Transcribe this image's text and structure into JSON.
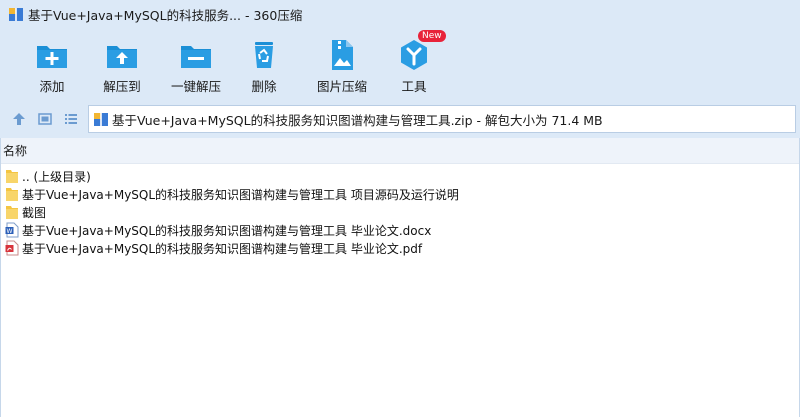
{
  "window": {
    "title": "基于Vue+Java+MySQL的科技服务... - 360压缩"
  },
  "toolbar": {
    "items": [
      {
        "label": "添加",
        "icon": "add-icon"
      },
      {
        "label": "解压到",
        "icon": "extract-to-icon"
      },
      {
        "label": "一键解压",
        "icon": "one-key-extract-icon"
      },
      {
        "label": "删除",
        "icon": "recycle-delete-icon"
      },
      {
        "label": "图片压缩",
        "icon": "image-compress-icon"
      },
      {
        "label": "工具",
        "icon": "tools-icon",
        "badge": "New"
      }
    ]
  },
  "addressbar": {
    "path": "基于Vue+Java+MySQL的科技服务知识图谱构建与管理工具.zip - 解包大小为 71.4 MB"
  },
  "filelist": {
    "column_name": "名称",
    "rows": [
      {
        "name": ".. (上级目录)",
        "type": "folder"
      },
      {
        "name": "基于Vue+Java+MySQL的科技服务知识图谱构建与管理工具 项目源码及运行说明",
        "type": "folder"
      },
      {
        "name": "截图",
        "type": "folder"
      },
      {
        "name": "基于Vue+Java+MySQL的科技服务知识图谱构建与管理工具 毕业论文.docx",
        "type": "docx"
      },
      {
        "name": "基于Vue+Java+MySQL的科技服务知识图谱构建与管理工具 毕业论文.pdf",
        "type": "pdf"
      }
    ]
  },
  "colors": {
    "chrome_bg": "#dce9f7",
    "icon_blue": "#1b8fd6",
    "folder_yellow": "#f4c542",
    "badge_red": "#e8233a"
  }
}
